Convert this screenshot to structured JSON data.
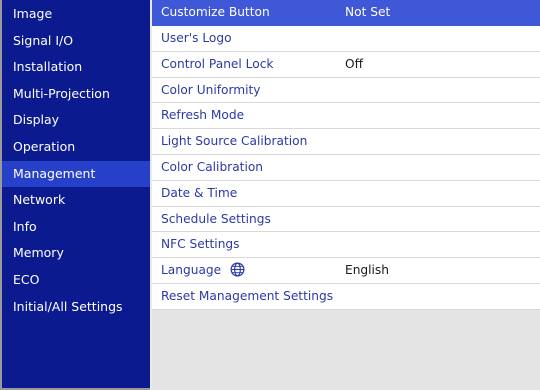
{
  "sidebar": {
    "items": [
      {
        "label": "Image"
      },
      {
        "label": "Signal I/O"
      },
      {
        "label": "Installation"
      },
      {
        "label": "Multi-Projection"
      },
      {
        "label": "Display"
      },
      {
        "label": "Operation"
      },
      {
        "label": "Management",
        "active": true
      },
      {
        "label": "Network"
      },
      {
        "label": "Info"
      },
      {
        "label": "Memory"
      },
      {
        "label": "ECO"
      },
      {
        "label": "Initial/All Settings"
      }
    ]
  },
  "management": {
    "rows": [
      {
        "label": "Customize Button",
        "value": "Not Set"
      },
      {
        "label": "User's Logo",
        "value": ""
      },
      {
        "label": "Control Panel Lock",
        "value": "Off"
      },
      {
        "label": "Color Uniformity",
        "value": ""
      },
      {
        "label": "Refresh Mode",
        "value": ""
      },
      {
        "label": "Light Source Calibration",
        "value": ""
      },
      {
        "label": "Color Calibration",
        "value": ""
      },
      {
        "label": "Date & Time",
        "value": ""
      },
      {
        "label": "Schedule Settings",
        "value": ""
      },
      {
        "label": "NFC Settings",
        "value": ""
      },
      {
        "label": "Language",
        "value": "English",
        "icon": "globe-icon"
      },
      {
        "label": "Reset Management Settings",
        "value": ""
      }
    ]
  },
  "colors": {
    "sidebar_bg": "#0c1a8f",
    "sidebar_active": "#2740c9",
    "row_selected": "#3f58d8",
    "row_text": "#2b3aa6"
  }
}
